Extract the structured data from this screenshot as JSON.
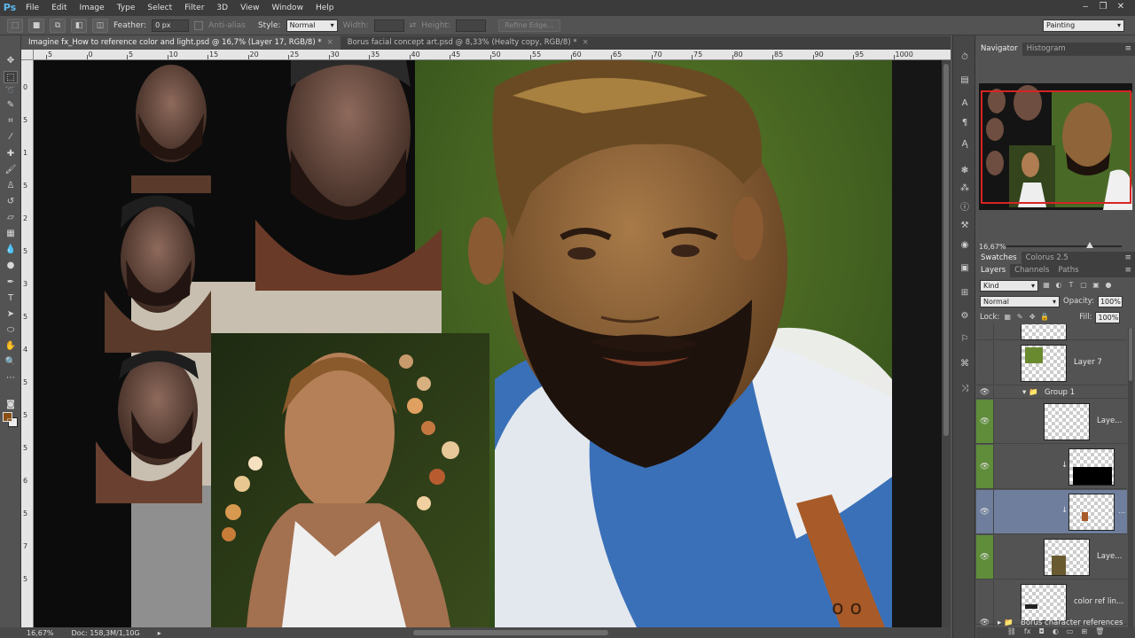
{
  "menubar": {
    "logo": "Ps",
    "items": [
      "File",
      "Edit",
      "Image",
      "Type",
      "Select",
      "Filter",
      "3D",
      "View",
      "Window",
      "Help"
    ],
    "window_controls": [
      "minimize-icon",
      "restore-icon",
      "close-icon"
    ]
  },
  "options_bar": {
    "feather_label": "Feather:",
    "feather_value": "0 px",
    "antialias_label": "Anti-alias",
    "style_label": "Style:",
    "style_value": "Normal",
    "width_label": "Width:",
    "height_label": "Height:",
    "refine_edge_label": "Refine Edge...",
    "workspace_value": "Painting"
  },
  "tabs": [
    {
      "label": "Imagine fx_How to reference color and light.psd @ 16,7% (Layer 17, RGB/8) *",
      "close": "×",
      "active": true
    },
    {
      "label": "Borus facial concept art.psd @ 8,33% (Healty copy, RGB/8) *",
      "close": "×",
      "active": false
    }
  ],
  "rulers": {
    "h_labels": [
      "5",
      "0",
      "5",
      "10",
      "15",
      "20",
      "25",
      "30",
      "35",
      "40",
      "45",
      "50",
      "55",
      "60",
      "65",
      "70",
      "75",
      "80",
      "85",
      "90",
      "95",
      "1000"
    ],
    "v_labels": [
      "0",
      "5",
      "1",
      "5",
      "2",
      "5",
      "3",
      "5",
      "4",
      "5",
      "5",
      "5",
      "6",
      "5",
      "7",
      "5"
    ]
  },
  "statusbar": {
    "zoom": "16,67%",
    "doc_info": "Doc: 158,3M/1,10G"
  },
  "navigator": {
    "tabs": [
      "Navigator",
      "Histogram"
    ],
    "zoom": "16,67%"
  },
  "swatches_panel": {
    "tabs": [
      "Swatches",
      "Colorus 2.5"
    ]
  },
  "layers_panel": {
    "tabs": [
      "Layers",
      "Channels",
      "Paths"
    ],
    "kind_value": "Kind",
    "blend_mode": "Normal",
    "opacity_label": "Opacity:",
    "opacity_value": "100%",
    "lock_label": "Lock:",
    "fill_label": "Fill:",
    "fill_value": "100%",
    "layers": [
      {
        "name": "",
        "visible": false
      },
      {
        "name": "Layer 7",
        "visible": false
      },
      {
        "name": "Group 1",
        "visible": true
      },
      {
        "name": "Laye...",
        "visible": true
      },
      {
        "name": "",
        "visible": true
      },
      {
        "name": "...",
        "visible": true
      },
      {
        "name": "Laye...",
        "visible": true
      },
      {
        "name": "color ref lin...",
        "visible": false
      },
      {
        "name": "Borus character references",
        "visible": true
      }
    ],
    "bottom_icons": [
      "link-icon",
      "fx-icon",
      "mask-icon",
      "adjustment-icon",
      "folder-icon",
      "new-layer-icon",
      "trash-icon"
    ]
  },
  "colors": {
    "foreground": "#8a4f16",
    "background": "#eeeeee",
    "selection_highlight": "#6e7e9c",
    "visibility_green": "#5f8d3a"
  }
}
